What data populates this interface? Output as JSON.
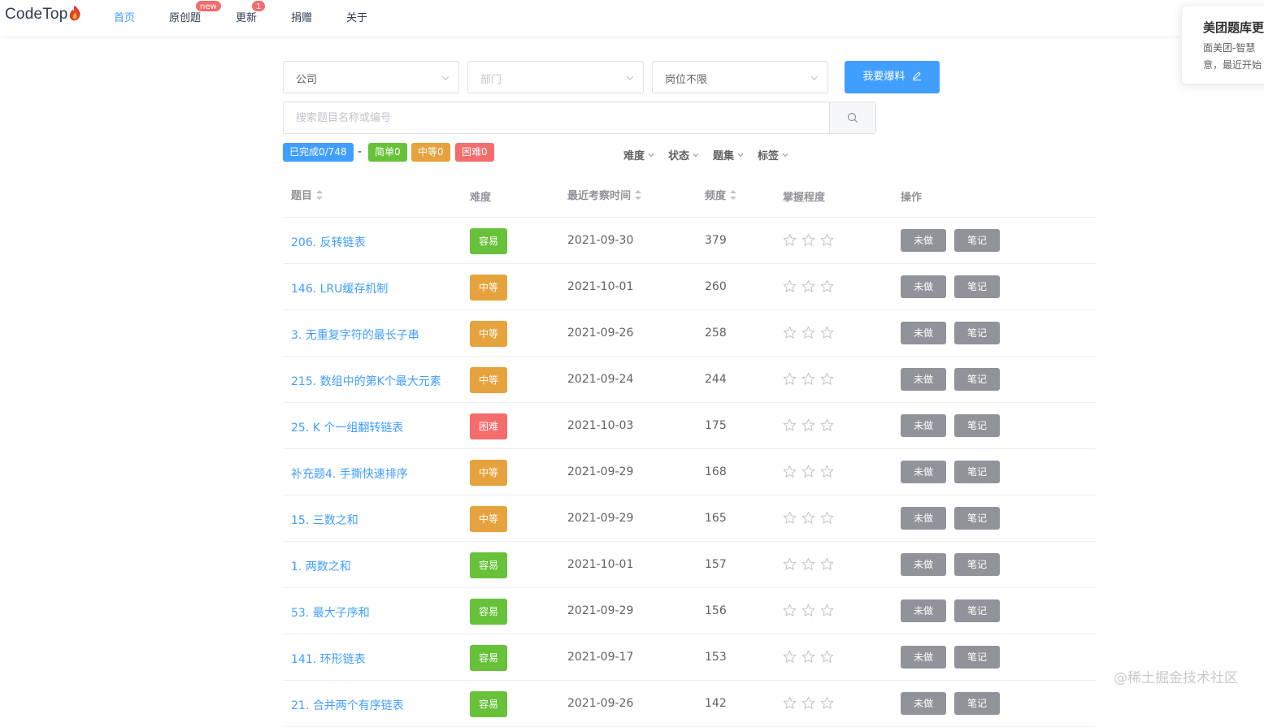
{
  "nav": {
    "logo": "CodeTop",
    "items": [
      {
        "label": "首页",
        "active": true
      },
      {
        "label": "原创题",
        "badge": "new"
      },
      {
        "label": "更新",
        "badge": "1"
      },
      {
        "label": "捐赠"
      },
      {
        "label": "关于"
      }
    ]
  },
  "notice": {
    "title": "美团题库更",
    "line1": "面美团-智慧",
    "line2": "意，最近开始"
  },
  "filters": {
    "company": "公司",
    "department_placeholder": "部门",
    "position": "岗位不限",
    "report_button": "我要爆料"
  },
  "search": {
    "placeholder": "搜索题目名称或编号"
  },
  "stats": {
    "completed": "已完成0/748",
    "dash": "-",
    "easy": "简单0",
    "medium": "中等0",
    "hard": "困难0"
  },
  "column_filters": [
    "难度",
    "状态",
    "题集",
    "标签"
  ],
  "table": {
    "headers": [
      "题目",
      "难度",
      "最近考察时间",
      "频度",
      "掌握程度",
      "操作"
    ],
    "action_todo": "未做",
    "action_note": "笔记",
    "rows": [
      {
        "title": "206. 反转链表",
        "difficulty": "容易",
        "level": "easy",
        "date": "2021-09-30",
        "freq": "379"
      },
      {
        "title": "146. LRU缓存机制",
        "difficulty": "中等",
        "level": "medium",
        "date": "2021-10-01",
        "freq": "260"
      },
      {
        "title": "3. 无重复字符的最长子串",
        "difficulty": "中等",
        "level": "medium",
        "date": "2021-09-26",
        "freq": "258"
      },
      {
        "title": "215. 数组中的第K个最大元素",
        "difficulty": "中等",
        "level": "medium",
        "date": "2021-09-24",
        "freq": "244"
      },
      {
        "title": "25. K 个一组翻转链表",
        "difficulty": "困难",
        "level": "hard",
        "date": "2021-10-03",
        "freq": "175"
      },
      {
        "title": "补充题4. 手撕快速排序",
        "difficulty": "中等",
        "level": "medium",
        "date": "2021-09-29",
        "freq": "168"
      },
      {
        "title": "15. 三数之和",
        "difficulty": "中等",
        "level": "medium",
        "date": "2021-09-29",
        "freq": "165"
      },
      {
        "title": "1. 两数之和",
        "difficulty": "容易",
        "level": "easy",
        "date": "2021-10-01",
        "freq": "157"
      },
      {
        "title": "53. 最大子序和",
        "difficulty": "容易",
        "level": "easy",
        "date": "2021-09-29",
        "freq": "156"
      },
      {
        "title": "141. 环形链表",
        "difficulty": "容易",
        "level": "easy",
        "date": "2021-09-17",
        "freq": "153"
      },
      {
        "title": "21. 合并两个有序链表",
        "difficulty": "容易",
        "level": "easy",
        "date": "2021-09-26",
        "freq": "142"
      }
    ]
  },
  "colors": {
    "primary": "#409eff",
    "easy": "#67c23a",
    "medium": "#e6a23c",
    "hard": "#f56c6c",
    "gray_button": "#909399"
  },
  "watermark": "@稀土掘金技术社区"
}
